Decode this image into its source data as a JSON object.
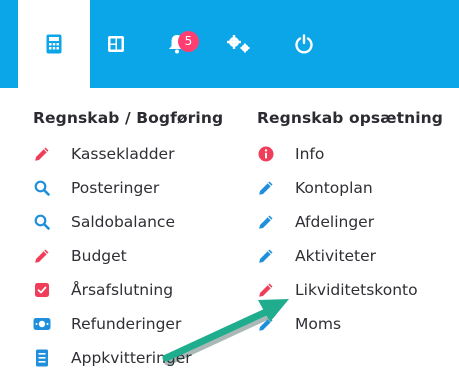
{
  "colors": {
    "topbar": "#0aa6e8",
    "red": "#ef3d5a",
    "blue": "#1f8fdc",
    "annotation_arrow": "#1fad8d"
  },
  "topbar": {
    "icons": [
      "calculator-icon",
      "dashboard-icon",
      "bell-icon",
      "settings-icon",
      "power-icon"
    ],
    "notification_count": "5"
  },
  "menu": {
    "left_title": "Regnskab / Bogføring",
    "right_title": "Regnskab opsætning",
    "left_items": [
      {
        "label": "Kassekladder",
        "icon": "pencil-icon"
      },
      {
        "label": "Posteringer",
        "icon": "search-icon"
      },
      {
        "label": "Saldobalance",
        "icon": "search-icon"
      },
      {
        "label": "Budget",
        "icon": "pencil-icon"
      },
      {
        "label": "Årsafslutning",
        "icon": "checkbox-icon"
      },
      {
        "label": "Refunderinger",
        "icon": "money-icon"
      },
      {
        "label": "Appkvitteringer",
        "icon": "receipt-icon"
      }
    ],
    "right_items": [
      {
        "label": "Info",
        "icon": "info-icon"
      },
      {
        "label": "Kontoplan",
        "icon": "pencil-icon"
      },
      {
        "label": "Afdelinger",
        "icon": "pencil-icon"
      },
      {
        "label": "Aktiviteter",
        "icon": "pencil-icon"
      },
      {
        "label": "Likviditetskonto",
        "icon": "pencil-icon"
      },
      {
        "label": "Moms",
        "icon": "pencil-icon"
      }
    ]
  }
}
